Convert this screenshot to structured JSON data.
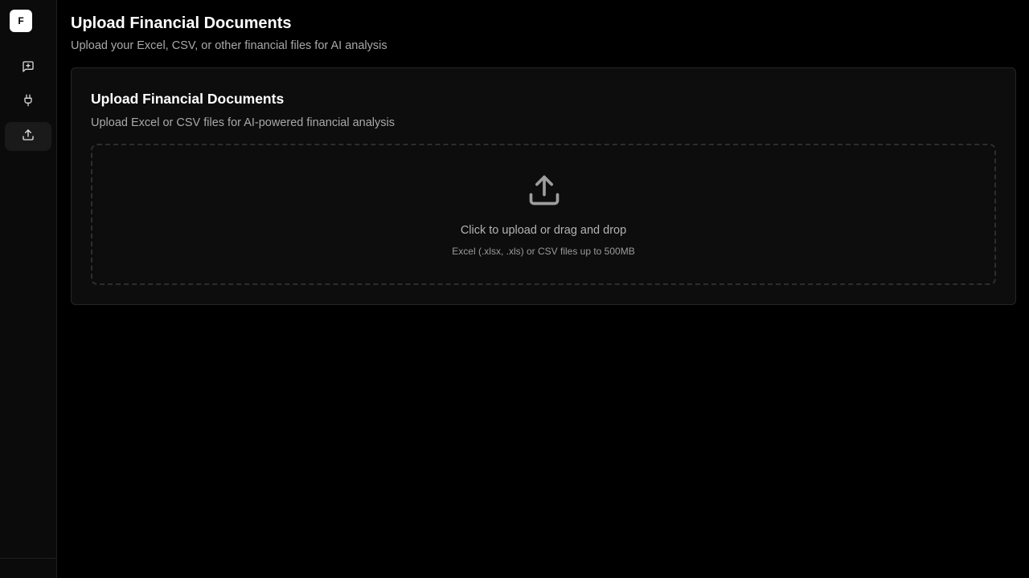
{
  "sidebar": {
    "logo_letter": "F",
    "items": [
      {
        "name": "chat",
        "icon": "message-plus-icon",
        "active": false
      },
      {
        "name": "integrations",
        "icon": "plug-icon",
        "active": false
      },
      {
        "name": "upload",
        "icon": "upload-icon",
        "active": true
      }
    ]
  },
  "header": {
    "title": "Upload Financial Documents",
    "subtitle": "Upload your Excel, CSV, or other financial files for AI analysis"
  },
  "card": {
    "title": "Upload Financial Documents",
    "subtitle": "Upload Excel or CSV files for AI-powered financial analysis",
    "dropzone": {
      "icon": "upload-icon",
      "primary_text": "Click to upload or drag and drop",
      "secondary_text": "Excel (.xlsx, .xls) or CSV files up to 500MB"
    }
  },
  "colors": {
    "background": "#000000",
    "sidebar": "#0b0b0b",
    "card": "#0d0d0d",
    "border": "#262626",
    "text_primary": "#ffffff",
    "text_muted": "#a9a9a9"
  }
}
